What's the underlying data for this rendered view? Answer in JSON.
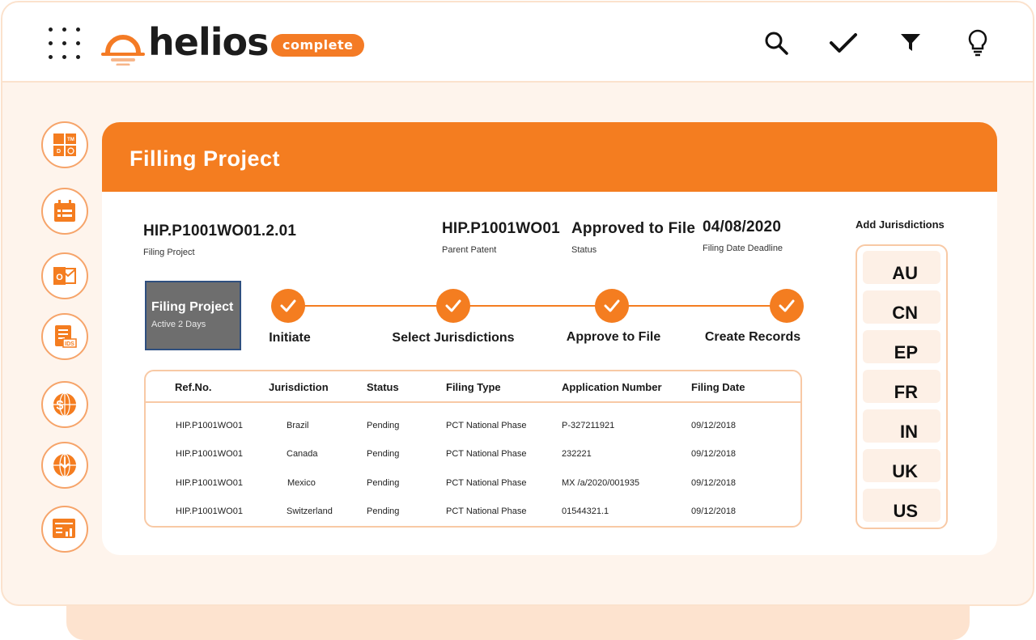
{
  "brand": {
    "name": "helios",
    "edition": "complete",
    "accent_color": "#f47d20"
  },
  "toolbar": {
    "icons": [
      "search-icon",
      "check-icon",
      "filter-icon",
      "lightbulb-icon"
    ]
  },
  "sidebar": {
    "items": [
      {
        "icon": "trademark-grid-icon",
        "TM": "TM",
        "D": "D"
      },
      {
        "icon": "calendar-icon"
      },
      {
        "icon": "outlook-icon",
        "letter": "O"
      },
      {
        "icon": "ids-document-icon",
        "text": "IDS"
      },
      {
        "icon": "currency-globe-icon"
      },
      {
        "icon": "globe-download-icon"
      },
      {
        "icon": "report-chart-icon"
      }
    ]
  },
  "page": {
    "title": "Filling Project"
  },
  "details": {
    "project_id": "HIP.P1001WO01.2.01",
    "project_id_label": "Filing Project",
    "parent_patent": "HIP.P1001WO01",
    "parent_patent_label": "Parent Patent",
    "status": "Approved to File",
    "status_label": "Status",
    "deadline": "04/08/2020",
    "deadline_label": "Filing Date Deadline"
  },
  "active": {
    "title": "Filing Project",
    "subtitle": "Active 2 Days"
  },
  "steps": [
    {
      "label": "Initiate",
      "done": true
    },
    {
      "label": "Select Jurisdictions",
      "done": true
    },
    {
      "label": "Approve to File",
      "done": true
    },
    {
      "label": "Create Records",
      "done": true
    }
  ],
  "table": {
    "headers": [
      "Ref.No.",
      "Jurisdiction",
      "Status",
      "Filing Type",
      "Application Number",
      "Filing Date"
    ],
    "rows": [
      [
        "HIP.P1001WO01",
        "Brazil",
        "Pending",
        "PCT National Phase",
        "P-327211921",
        "09/12/2018"
      ],
      [
        "HIP.P1001WO01",
        "Canada",
        "Pending",
        "PCT National Phase",
        "232221",
        "09/12/2018"
      ],
      [
        "HIP.P1001WO01",
        "Mexico",
        "Pending",
        "PCT National Phase",
        "MX /a/2020/001935",
        "09/12/2018"
      ],
      [
        "HIP.P1001WO01",
        "Switzerland",
        "Pending",
        "PCT National Phase",
        "01544321.1",
        "09/12/2018"
      ]
    ]
  },
  "jurisdictions": {
    "title": "Add Jurisdictions",
    "items": [
      "AU",
      "CN",
      "EP",
      "FR",
      "IN",
      "UK",
      "US"
    ]
  }
}
